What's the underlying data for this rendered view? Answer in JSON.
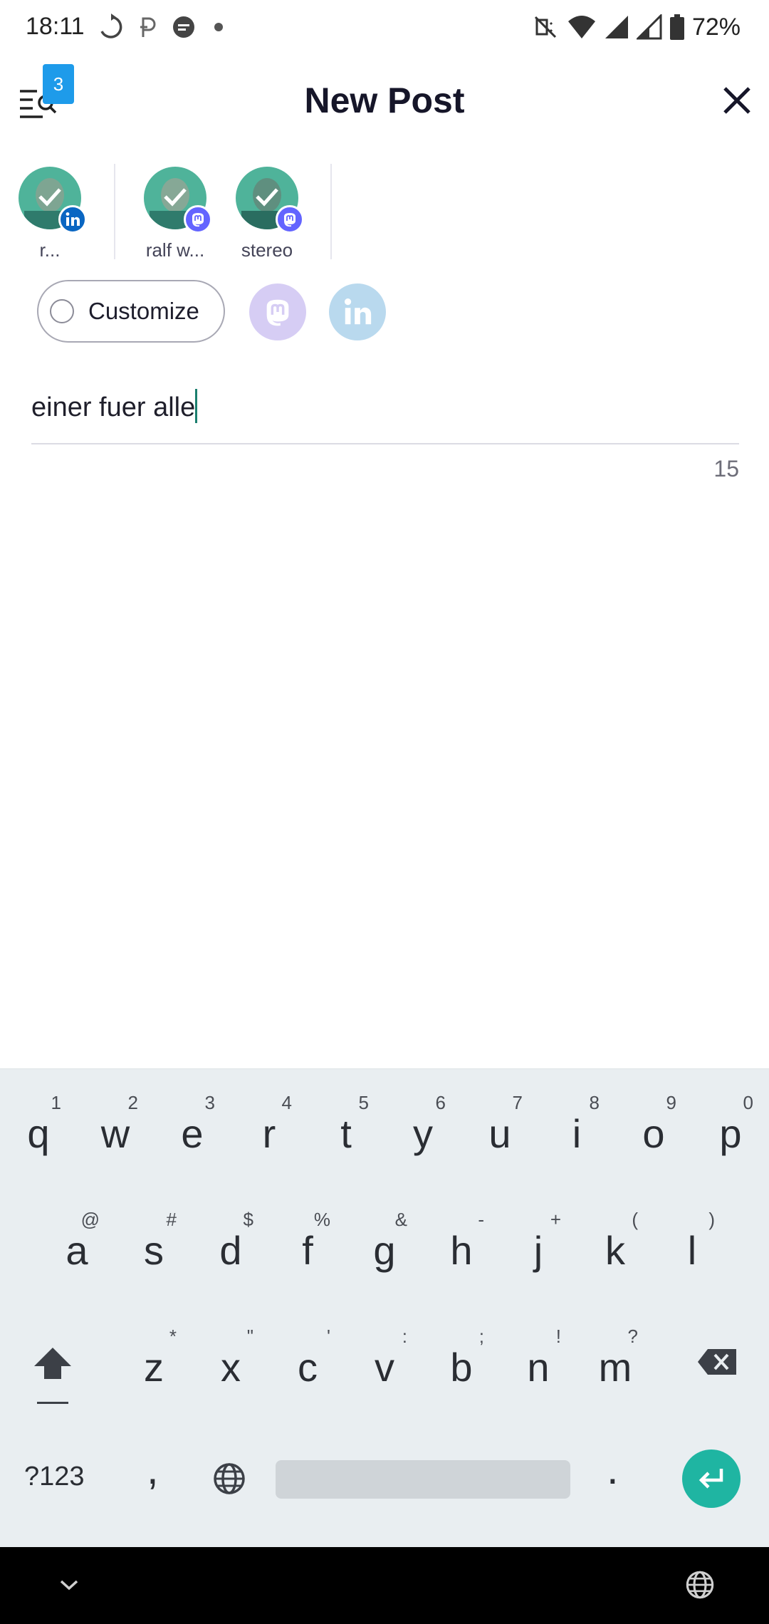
{
  "status_bar": {
    "time": "18:11",
    "battery_pct": "72%",
    "icons": [
      "sync-icon",
      "parking-icon",
      "chat-icon",
      "dot-icon",
      "mute-icon",
      "wifi-icon",
      "signal-icon",
      "battery-icon"
    ]
  },
  "header": {
    "title": "New Post",
    "queue_badge": "3"
  },
  "accounts": [
    {
      "label": "r...",
      "network": "linkedin"
    },
    {
      "label": "ralf w...",
      "network": "mastodon"
    },
    {
      "label": "stereo",
      "network": "mastodon"
    }
  ],
  "customize": {
    "label": "Customize"
  },
  "composer": {
    "text": "einer fuer alle",
    "char_count": "15"
  },
  "keyboard": {
    "row1": [
      {
        "k": "q",
        "a": "1"
      },
      {
        "k": "w",
        "a": "2"
      },
      {
        "k": "e",
        "a": "3"
      },
      {
        "k": "r",
        "a": "4"
      },
      {
        "k": "t",
        "a": "5"
      },
      {
        "k": "y",
        "a": "6"
      },
      {
        "k": "u",
        "a": "7"
      },
      {
        "k": "i",
        "a": "8"
      },
      {
        "k": "o",
        "a": "9"
      },
      {
        "k": "p",
        "a": "0"
      }
    ],
    "row2": [
      {
        "k": "a",
        "a": "@"
      },
      {
        "k": "s",
        "a": "#"
      },
      {
        "k": "d",
        "a": "$"
      },
      {
        "k": "f",
        "a": "%"
      },
      {
        "k": "g",
        "a": "&"
      },
      {
        "k": "h",
        "a": "-"
      },
      {
        "k": "j",
        "a": "+"
      },
      {
        "k": "k",
        "a": "("
      },
      {
        "k": "l",
        "a": ")"
      }
    ],
    "row3": [
      {
        "k": "z",
        "a": "*"
      },
      {
        "k": "x",
        "a": "\""
      },
      {
        "k": "c",
        "a": "'"
      },
      {
        "k": "v",
        "a": ":"
      },
      {
        "k": "b",
        "a": ";"
      },
      {
        "k": "n",
        "a": "!"
      },
      {
        "k": "m",
        "a": "?"
      }
    ],
    "symbols_label": "?123",
    "comma_label": ",",
    "period_label": "."
  },
  "colors": {
    "accent": "#1e9bea",
    "mastodon": "#6364ff",
    "linkedin": "#0a66c2",
    "enter": "#1fb5a2"
  }
}
